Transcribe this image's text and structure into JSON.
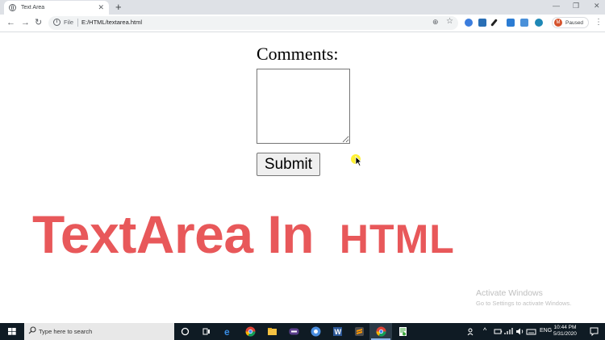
{
  "browser": {
    "tab_title": "Text Area",
    "tab_close": "✕",
    "new_tab": "+",
    "window_controls": [
      "—",
      "❐",
      "✕"
    ],
    "nav": {
      "back": "←",
      "forward": "→",
      "reload": "↻"
    },
    "omnibox": {
      "scheme_label": "File",
      "url": "E:/HTML/textarea.html"
    },
    "profile": {
      "initial": "M",
      "status": "Paused"
    },
    "menu": "⋮",
    "extension_icons": [
      "blue-circle-extension-icon",
      "nia-extension-icon",
      "pen-extension-icon",
      "b-extension-icon",
      "blue-square-extension-icon",
      "teal-circle-extension-icon"
    ]
  },
  "page": {
    "label": "Comments:",
    "textarea_value": "",
    "submit_label": "Submit"
  },
  "overlay": {
    "word1": "TextArea",
    "word2": "In",
    "word3": "HTML",
    "color": "#e8585a"
  },
  "watermark": {
    "line1": "Activate Windows",
    "line2": "Go to Settings to activate Windows."
  },
  "taskbar": {
    "search_placeholder": "Type here to search",
    "tray_lang": "ENG",
    "time": "10:44 PM",
    "date": "5/31/2020",
    "apps": [
      "cortana-icon",
      "task-view-icon",
      "edge-icon",
      "chrome-icon",
      "file-explorer-icon",
      "media-app-icon",
      "chrome-blue-icon",
      "word-icon",
      "sublime-text-icon",
      "chrome-active-icon",
      "notepad-plus-icon"
    ]
  }
}
